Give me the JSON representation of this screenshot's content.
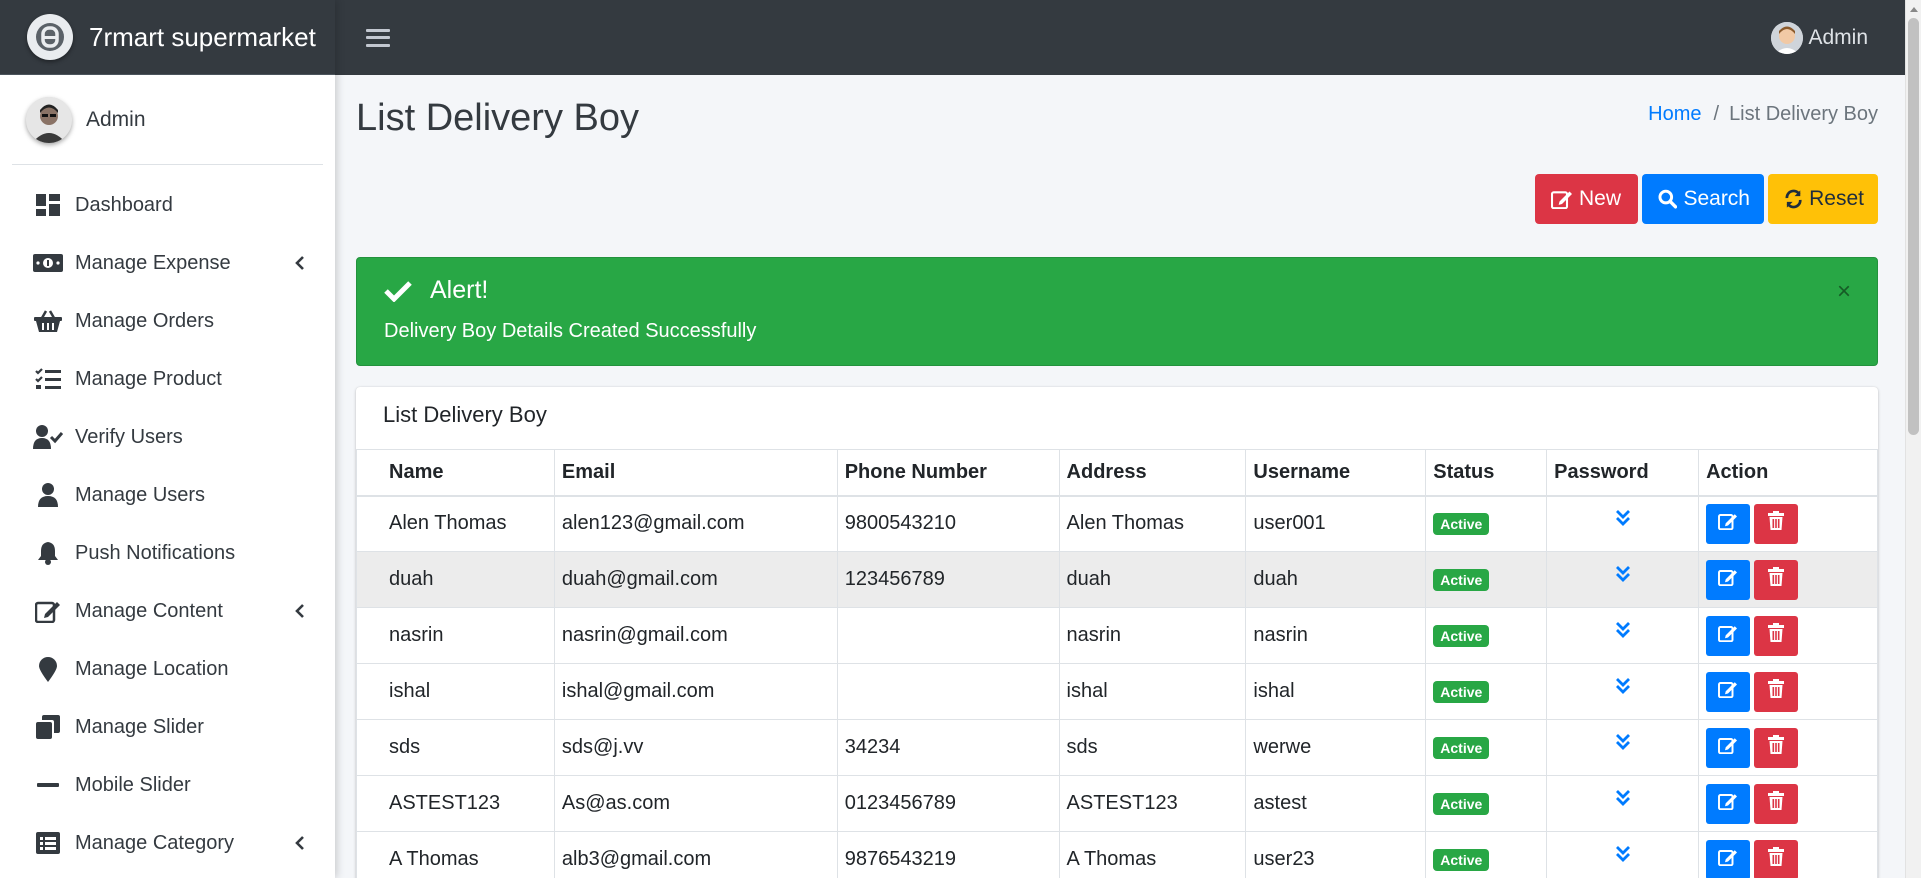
{
  "brand": {
    "name": "7rmart supermarket"
  },
  "sidebar": {
    "user_name": "Admin",
    "items": [
      {
        "label": "Dashboard",
        "icon": "dashboard-icon",
        "has_submenu": false
      },
      {
        "label": "Manage Expense",
        "icon": "money-bill-icon",
        "has_submenu": true
      },
      {
        "label": "Manage Orders",
        "icon": "basket-icon",
        "has_submenu": false
      },
      {
        "label": "Manage Product",
        "icon": "tasks-icon",
        "has_submenu": false
      },
      {
        "label": "Verify Users",
        "icon": "user-check-icon",
        "has_submenu": false
      },
      {
        "label": "Manage Users",
        "icon": "user-icon",
        "has_submenu": false
      },
      {
        "label": "Push Notifications",
        "icon": "bell-icon",
        "has_submenu": false
      },
      {
        "label": "Manage Content",
        "icon": "edit-icon",
        "has_submenu": true
      },
      {
        "label": "Manage Location",
        "icon": "map-marker-icon",
        "has_submenu": false
      },
      {
        "label": "Manage Slider",
        "icon": "clone-icon",
        "has_submenu": false
      },
      {
        "label": "Mobile Slider",
        "icon": "minus-icon",
        "has_submenu": false
      },
      {
        "label": "Manage Category",
        "icon": "list-alt-icon",
        "has_submenu": true
      }
    ]
  },
  "topbar": {
    "user_name": "Admin"
  },
  "page": {
    "title": "List Delivery Boy",
    "breadcrumb": {
      "home": "Home",
      "current": "List Delivery Boy"
    }
  },
  "actions": {
    "new": "New",
    "search": "Search",
    "reset": "Reset"
  },
  "alert": {
    "title": "Alert!",
    "message": "Delivery Boy Details Created Successfully",
    "close": "×"
  },
  "card": {
    "title": "List Delivery Boy"
  },
  "table": {
    "columns": [
      "Name",
      "Email",
      "Phone Number",
      "Address",
      "Username",
      "Status",
      "Password",
      "Action"
    ],
    "rows": [
      {
        "name": "Alen Thomas",
        "email": "alen123@gmail.com",
        "phone": "9800543210",
        "address": "Alen Thomas",
        "username": "user001",
        "status": "Active"
      },
      {
        "name": "duah",
        "email": "duah@gmail.com",
        "phone": "123456789",
        "address": "duah",
        "username": "duah",
        "status": "Active"
      },
      {
        "name": "nasrin",
        "email": "nasrin@gmail.com",
        "phone": "",
        "address": "nasrin",
        "username": "nasrin",
        "status": "Active"
      },
      {
        "name": "ishal",
        "email": "ishal@gmail.com",
        "phone": "",
        "address": "ishal",
        "username": "ishal",
        "status": "Active"
      },
      {
        "name": "sds",
        "email": "sds@j.vv",
        "phone": "34234",
        "address": "sds",
        "username": "werwe",
        "status": "Active"
      },
      {
        "name": "ASTEST123",
        "email": "As@as.com",
        "phone": "0123456789",
        "address": "ASTEST123",
        "username": "astest",
        "status": "Active"
      },
      {
        "name": "A Thomas",
        "email": "alb3@gmail.com",
        "phone": "9876543219",
        "address": "A Thomas",
        "username": "user23",
        "status": "Active"
      }
    ]
  },
  "colors": {
    "navbar": "#343a40",
    "success": "#28a745",
    "primary": "#007bff",
    "danger": "#dc3545",
    "warning": "#ffc107",
    "background": "#f4f6f9"
  }
}
